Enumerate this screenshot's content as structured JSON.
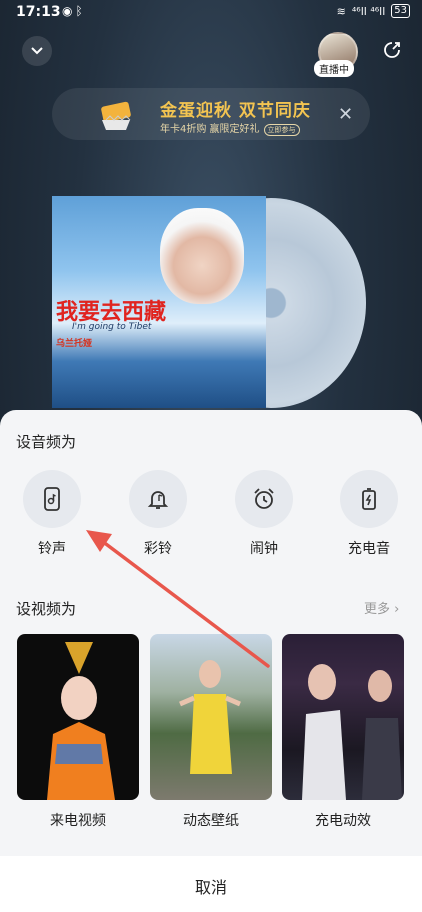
{
  "status_bar": {
    "time": "17:13",
    "network": "⁴⁶ll ⁴⁶ll",
    "battery": "53"
  },
  "player": {
    "live_badge": "直播中"
  },
  "promo": {
    "title": "金蛋迎秋 双节同庆",
    "subtitle": "年卡4折购 赢限定好礼",
    "tag": "立即参与"
  },
  "album": {
    "title": "我要去西藏",
    "english": "I'm going to Tibet",
    "artist": "乌兰托娅"
  },
  "sheet": {
    "audio_section_title": "设音频为",
    "audio_options": [
      {
        "label": "铃声",
        "icon": "phone-icon"
      },
      {
        "label": "彩铃",
        "icon": "bell-icon"
      },
      {
        "label": "闹钟",
        "icon": "alarm-clock-icon"
      },
      {
        "label": "充电音",
        "icon": "battery-charge-icon"
      }
    ],
    "video_section_title": "设视频为",
    "more_label": "更多",
    "video_options": [
      {
        "label": "来电视频"
      },
      {
        "label": "动态壁纸"
      },
      {
        "label": "充电动效"
      }
    ],
    "cancel_label": "取消"
  },
  "colors": {
    "accent_arrow": "#e8574c",
    "promo_gold": "#f3c451",
    "sheet_bg": "#f4f5f7"
  }
}
